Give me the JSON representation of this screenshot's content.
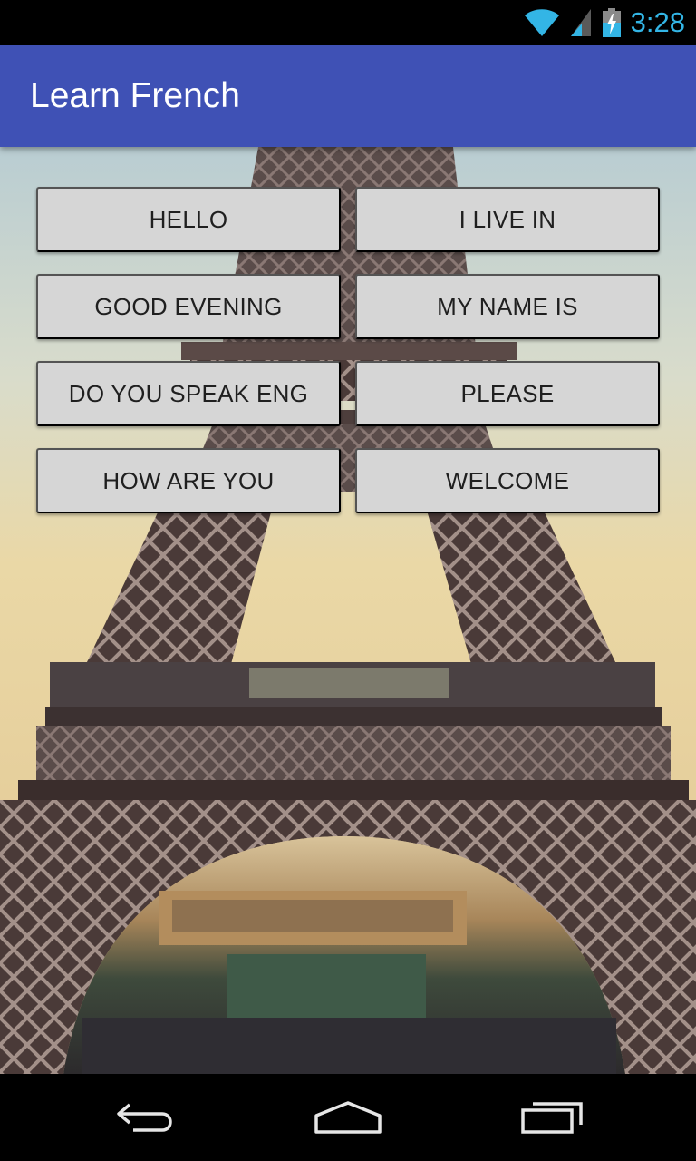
{
  "status_bar": {
    "time": "3:28",
    "icons": [
      "wifi-icon",
      "cell-signal-icon",
      "battery-charging-icon"
    ],
    "accent": "#33b5e5"
  },
  "app_bar": {
    "title": "Learn French",
    "color": "#3f51b5"
  },
  "phrases": [
    {
      "label": "HELLO"
    },
    {
      "label": "I LIVE IN"
    },
    {
      "label": "GOOD EVENING"
    },
    {
      "label": "MY NAME IS"
    },
    {
      "label": "DO YOU SPEAK ENG"
    },
    {
      "label": "PLEASE"
    },
    {
      "label": "HOW ARE YOU"
    },
    {
      "label": "WELCOME"
    }
  ],
  "background_image": "eiffel-tower-photo",
  "nav_bar": {
    "icons": [
      "back-icon",
      "home-icon",
      "recents-icon"
    ]
  }
}
